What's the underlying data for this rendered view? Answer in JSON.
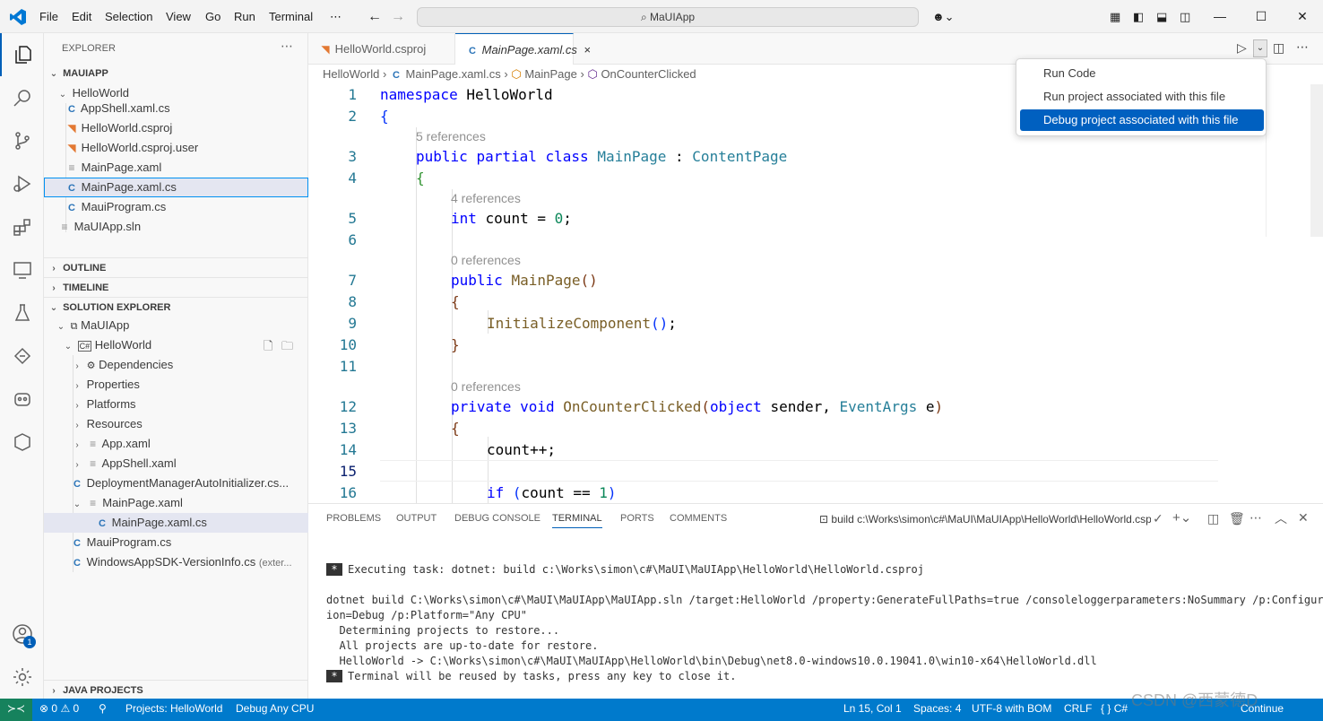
{
  "menu": [
    "File",
    "Edit",
    "Selection",
    "View",
    "Go",
    "Run",
    "Terminal"
  ],
  "command_center": "MaUIApp",
  "explorer": {
    "title": "EXPLORER",
    "root": "MAUIAPP",
    "folder": "HelloWorld",
    "files": [
      "AppShell.xaml.cs",
      "HelloWorld.csproj",
      "HelloWorld.csproj.user",
      "MainPage.xaml",
      "MainPage.xaml.cs",
      "MauiProgram.cs"
    ],
    "solution_file": "MaUIApp.sln",
    "outline": "OUTLINE",
    "timeline": "TIMELINE",
    "solution_explorer": "SOLUTION EXPLORER",
    "java_projects": "JAVA PROJECTS"
  },
  "solution": {
    "solution_name": "MaUIApp",
    "project": "HelloWorld",
    "nodes": [
      "Dependencies",
      "Properties",
      "Platforms",
      "Resources",
      "App.xaml",
      "AppShell.xaml",
      "DeploymentManagerAutoInitializer.cs..."
    ],
    "mainpage": "MainPage.xaml",
    "mainpage_cs": "MainPage.xaml.cs",
    "mauiprogram": "MauiProgram.cs",
    "sdk_info": "WindowsAppSDK-VersionInfo.cs",
    "sdk_suffix": "(exter..."
  },
  "tabs": [
    {
      "label": "HelloWorld.csproj"
    },
    {
      "label": "MainPage.xaml.cs",
      "close": "×"
    }
  ],
  "breadcrumb": [
    "HelloWorld",
    "MainPage.xaml.cs",
    "MainPage",
    "OnCounterClicked"
  ],
  "code": {
    "line_numbers": [
      "1",
      "2",
      "3",
      "4",
      "5",
      "6",
      "7",
      "8",
      "9",
      "10",
      "11",
      "12",
      "13",
      "14",
      "15",
      "16"
    ],
    "lens_5refs": "5 references",
    "lens_4refs": "4 references",
    "lens_0refs": "0 references"
  },
  "run_menu": [
    "Run Code",
    "Run project associated with this file",
    "Debug project associated with this file"
  ],
  "panel": {
    "tabs": [
      "PROBLEMS",
      "OUTPUT",
      "DEBUG CONSOLE",
      "TERMINAL",
      "PORTS",
      "COMMENTS"
    ],
    "task_label": "build c:\\Works\\simon\\c#\\MaUI\\MaUIApp\\HelloWorld\\HelloWorld.csproj",
    "terminal": [
      "Executing task: dotnet: build c:\\Works\\simon\\c#\\MaUI\\MaUIApp\\HelloWorld\\HelloWorld.csproj",
      "dotnet build C:\\Works\\simon\\c#\\MaUI\\MaUIApp\\MaUIApp.sln /target:HelloWorld /property:GenerateFullPaths=true /consoleloggerparameters:NoSummary /p:Configurat",
      "ion=Debug /p:Platform=\"Any CPU\"",
      "  Determining projects to restore...",
      "  All projects are up-to-date for restore.",
      "  HelloWorld -> C:\\Works\\simon\\c#\\MaUI\\MaUIApp\\HelloWorld\\bin\\Debug\\net8.0-windows10.0.19041.0\\win10-x64\\HelloWorld.dll",
      "Terminal will be reused by tasks, press any key to close it."
    ]
  },
  "status": {
    "errors": "0",
    "warnings": "0",
    "projects": "Projects: HelloWorld",
    "config": "Debug Any CPU",
    "position": "Ln 15, Col 1",
    "spaces": "Spaces: 4",
    "encoding": "UTF-8 with BOM",
    "eol": "CRLF",
    "language": "C#",
    "continue": "Continue",
    "watermark": "CSDN @西蒙德D"
  },
  "badge": "1",
  "colors": {
    "accent": "#007acc",
    "selection": "#0060c0"
  }
}
